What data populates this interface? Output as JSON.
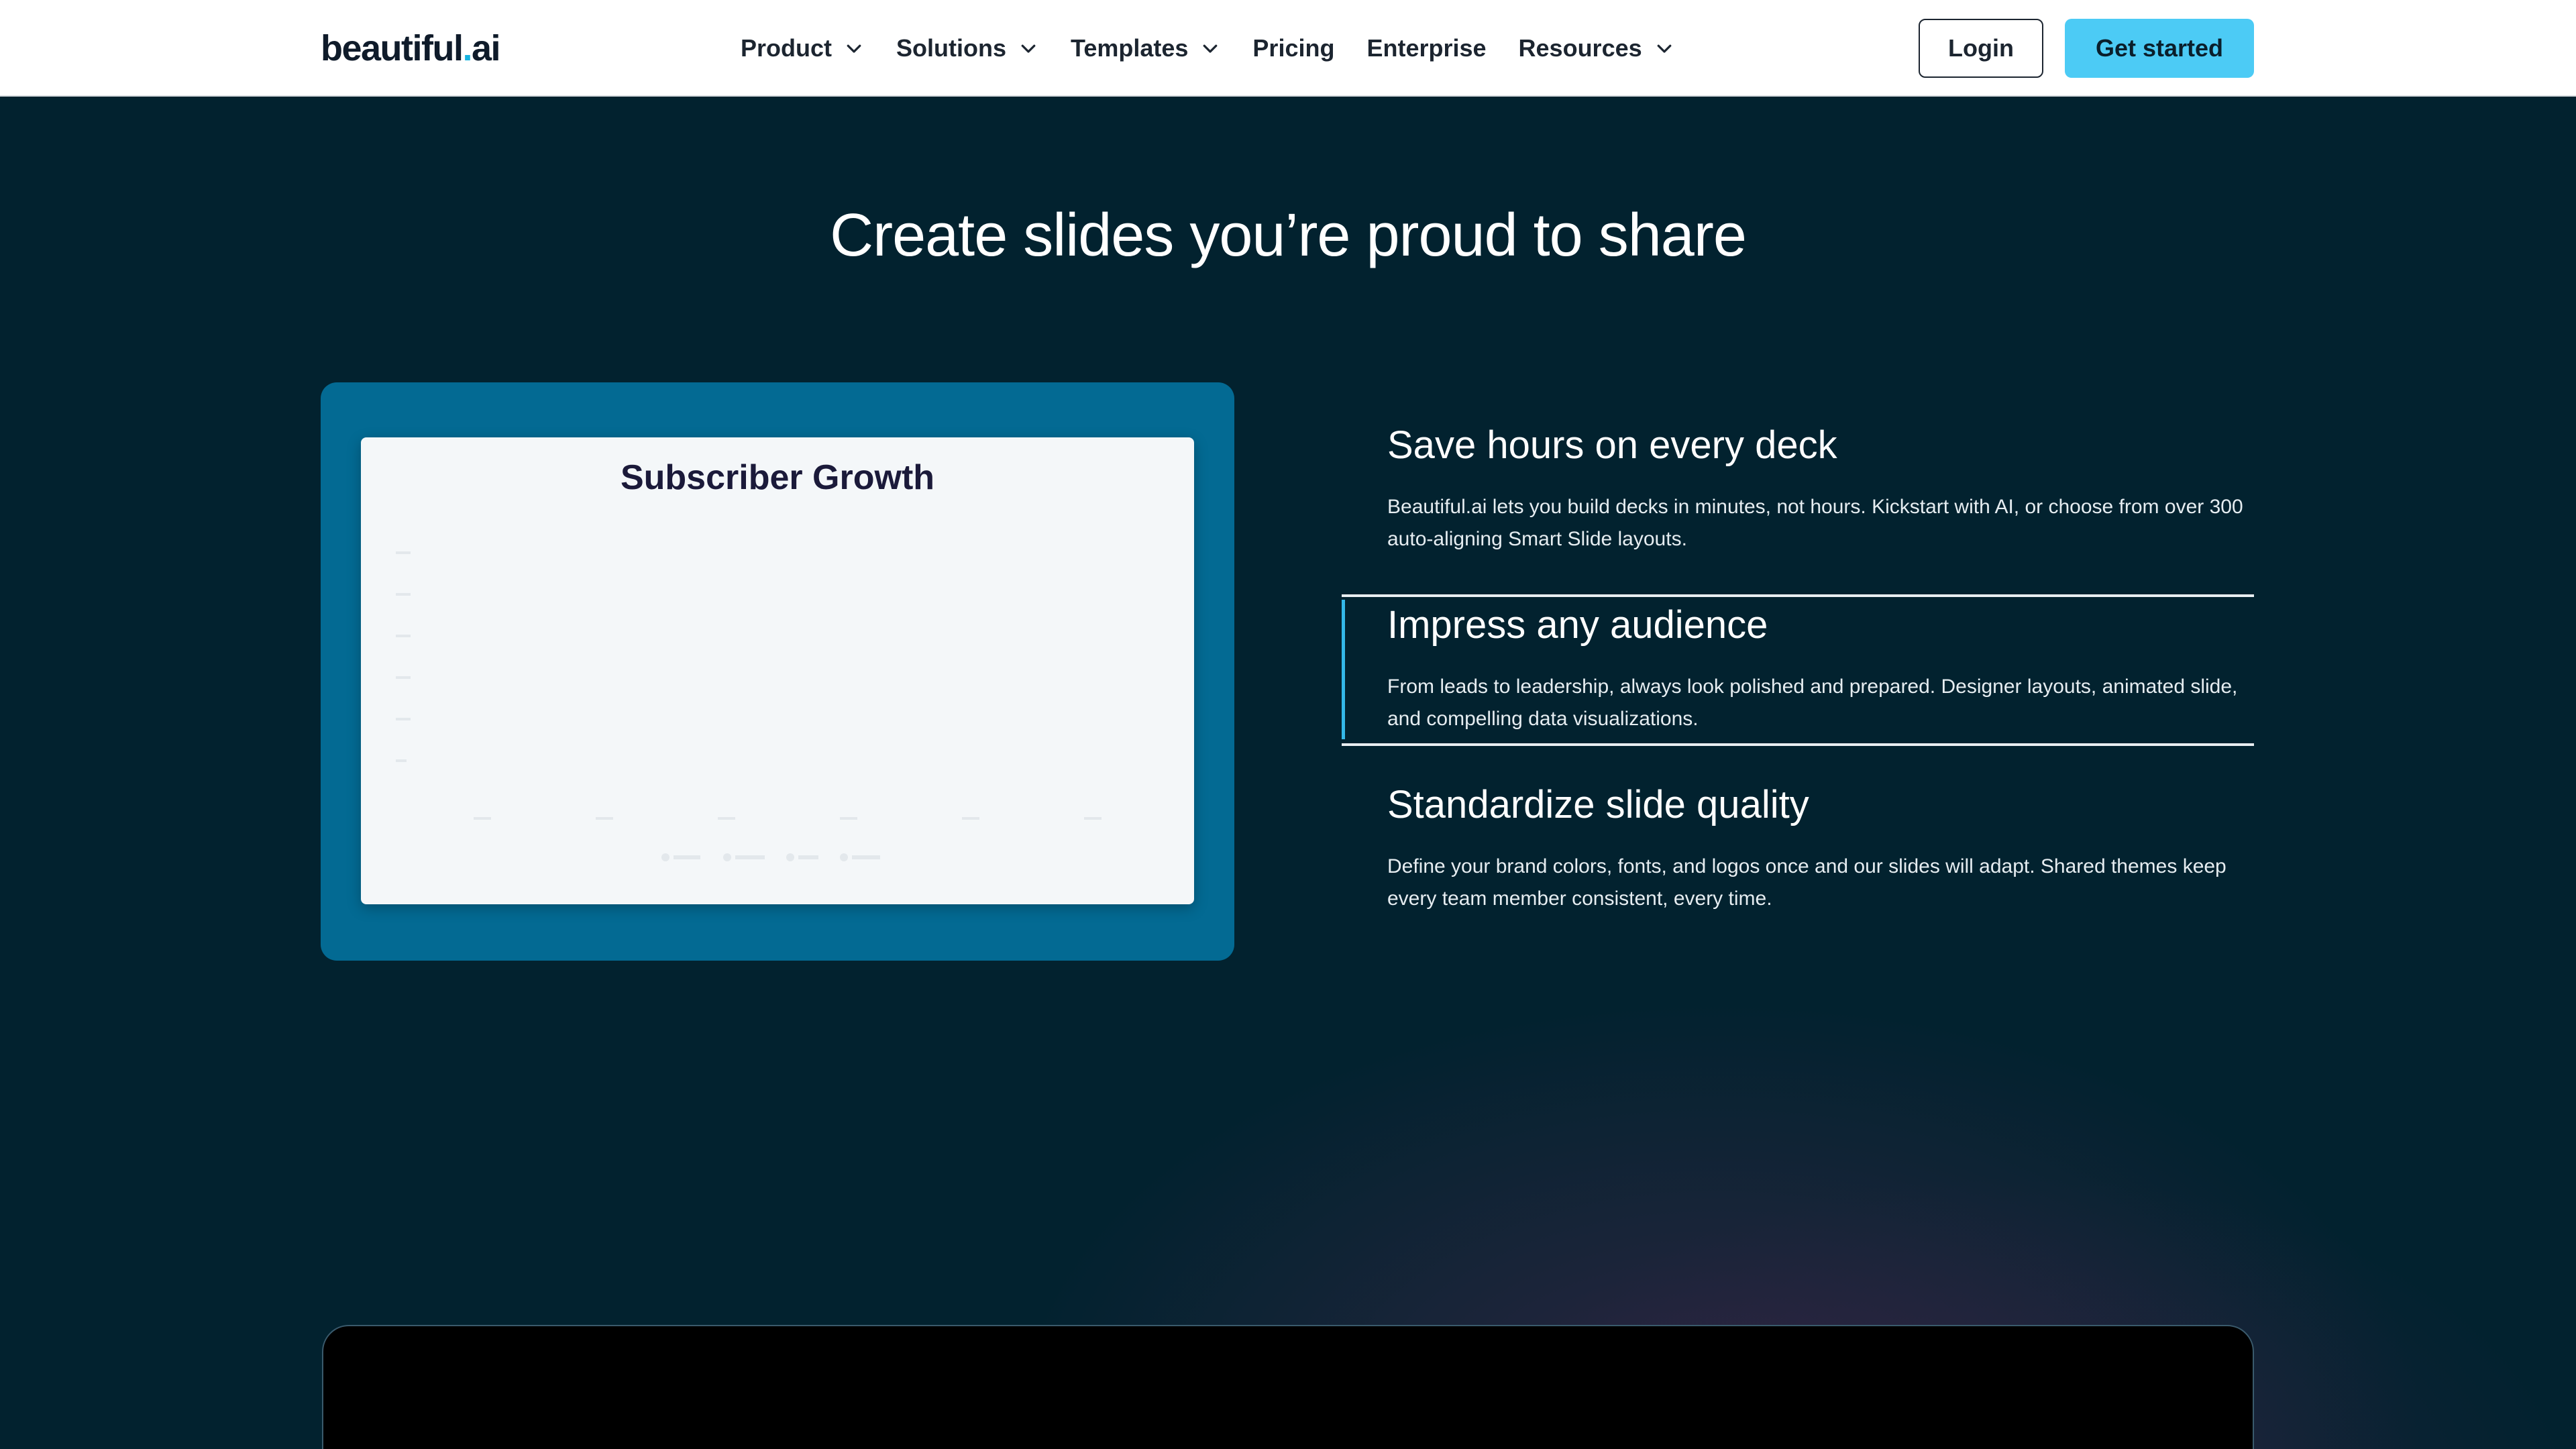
{
  "nav": {
    "logo_main": "beautiful",
    "logo_dot": ".",
    "logo_suffix": "ai",
    "items": [
      {
        "label": "Product",
        "has_dropdown": true
      },
      {
        "label": "Solutions",
        "has_dropdown": true
      },
      {
        "label": "Templates",
        "has_dropdown": true
      },
      {
        "label": "Pricing",
        "has_dropdown": false
      },
      {
        "label": "Enterprise",
        "has_dropdown": false
      },
      {
        "label": "Resources",
        "has_dropdown": true
      }
    ],
    "login_label": "Login",
    "cta_label": "Get started"
  },
  "hero": {
    "title": "Create slides you’re proud to share"
  },
  "preview": {
    "slide_title": "Subscriber Growth"
  },
  "features": [
    {
      "title": "Save hours on every deck",
      "description": "Beautiful.ai lets you build decks in minutes, not hours. Kickstart with AI, or choose from over 300 auto-aligning Smart Slide layouts.",
      "active": false
    },
    {
      "title": "Impress any audience",
      "description": "From leads to leadership, always look polished and prepared. Designer layouts, animated slide, and compelling data visualizations.",
      "active": true
    },
    {
      "title": "Standardize slide quality",
      "description": "Define your brand colors, fonts, and logos once and our slides will adapt. Shared themes keep every team member consistent, every time.",
      "active": false
    }
  ],
  "colors": {
    "background": "#02222f",
    "accent": "#4ccbf5",
    "preview_frame": "#036a93",
    "active_indicator": "#34b8e8"
  },
  "icons": {
    "dropdown": "chevron-down-icon"
  }
}
